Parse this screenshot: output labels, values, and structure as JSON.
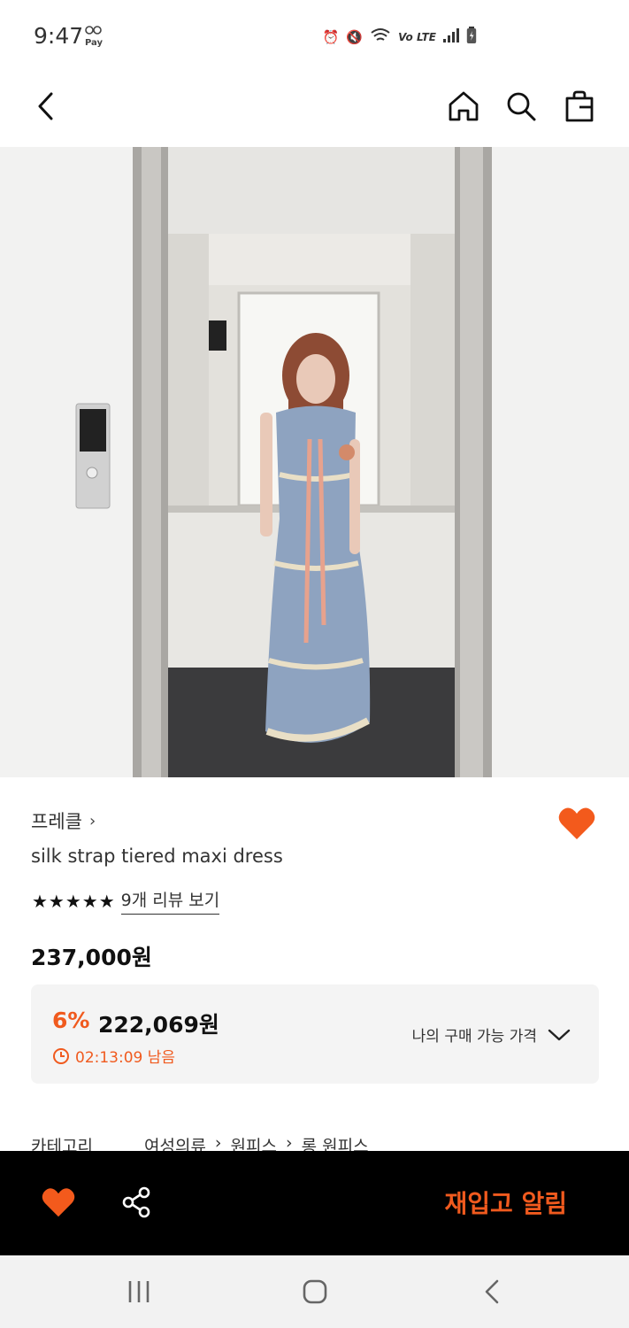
{
  "status_bar": {
    "time": "9:47",
    "pay_badge": "Pay",
    "lte_label": "Vo LTE"
  },
  "header": {
    "back_icon": "chevron-left-icon",
    "home_icon": "home-icon",
    "search_icon": "search-icon",
    "bag_icon": "shopping-bag-icon"
  },
  "product": {
    "brand": "프레클",
    "brand_chevron": "›",
    "name": "silk strap tiered maxi dress",
    "stars": "★★★★★",
    "review_link": "9개 리뷰 보기",
    "price": "237,000원",
    "sale": {
      "discount": "6%",
      "price": "222,069원",
      "timer": "02:13:09 남음",
      "available_price_label": "나의 구매 가능 가격"
    },
    "category": {
      "label": "카테고리",
      "path": [
        "여성의류",
        "원피스",
        "롱 원피스"
      ]
    }
  },
  "action_bar": {
    "restock_label": "재입고 알림"
  },
  "colors": {
    "accent": "#f05a1e",
    "action_bar_bg": "#000000"
  }
}
